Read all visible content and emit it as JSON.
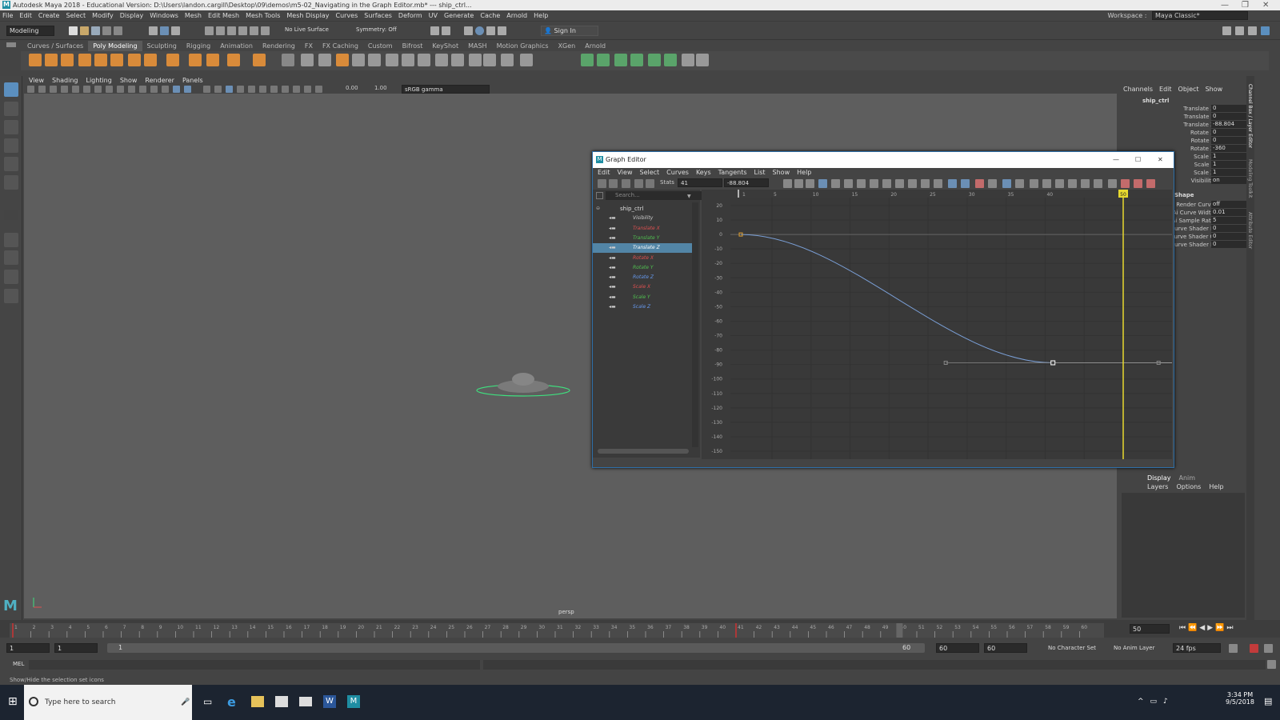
{
  "titlebar": {
    "text": "Autodesk Maya 2018 - Educational Version: D:\\Users\\landon.cargill\\Desktop\\09\\demos\\m5-02_Navigating in the Graph Editor.mb* --- ship_ctrl..."
  },
  "menubar": [
    "File",
    "Edit",
    "Create",
    "Select",
    "Modify",
    "Display",
    "Windows",
    "Mesh",
    "Edit Mesh",
    "Mesh Tools",
    "Mesh Display",
    "Curves",
    "Surfaces",
    "Deform",
    "UV",
    "Generate",
    "Cache",
    "Arnold",
    "Help"
  ],
  "workspace": {
    "label": "Workspace :",
    "value": "Maya Classic*"
  },
  "statusline": {
    "mode": "Modeling",
    "live_surface": "No Live Surface",
    "symmetry": "Symmetry: Off",
    "sign_in": "Sign In"
  },
  "shelf_tabs": [
    "Curves / Surfaces",
    "Poly Modeling",
    "Sculpting",
    "Rigging",
    "Animation",
    "Rendering",
    "FX",
    "FX Caching",
    "Custom",
    "Bifrost",
    "KeyShot",
    "MASH",
    "Motion Graphics",
    "XGen",
    "Arnold"
  ],
  "shelf_active": "Poly Modeling",
  "viewport": {
    "menu": [
      "View",
      "Shading",
      "Lighting",
      "Show",
      "Renderer",
      "Panels"
    ],
    "exposure": "0.00",
    "gamma": "1.00",
    "color_space": "sRGB gamma",
    "camera": "persp"
  },
  "channel_box": {
    "tabs": [
      "Channels",
      "Edit",
      "Object",
      "Show"
    ],
    "object": "ship_ctrl",
    "channels": [
      {
        "name": "Translate X",
        "value": "0"
      },
      {
        "name": "Translate Y",
        "value": "0"
      },
      {
        "name": "Translate Z",
        "value": "-88.804"
      },
      {
        "name": "Rotate X",
        "value": "0"
      },
      {
        "name": "Rotate Y",
        "value": "0"
      },
      {
        "name": "Rotate Z",
        "value": "-360"
      },
      {
        "name": "Scale X",
        "value": "1"
      },
      {
        "name": "Scale Y",
        "value": "1"
      },
      {
        "name": "Scale Z",
        "value": "1"
      },
      {
        "name": "Visibility",
        "value": "on"
      }
    ],
    "shape_label": "Shape",
    "shape_channels": [
      {
        "name": "Ai Render Curve",
        "value": "off"
      },
      {
        "name": "Ai Curve Width",
        "value": "0.01"
      },
      {
        "name": "Ai Sample Rate",
        "value": "5"
      },
      {
        "name": "Ai Curve Shader R",
        "value": "0"
      },
      {
        "name": "Ai Curve Shader G",
        "value": "0"
      },
      {
        "name": "Ai Curve Shader B",
        "value": "0"
      }
    ]
  },
  "layer_editor": {
    "tabs": [
      "Display",
      "Anim"
    ],
    "menu": [
      "Layers",
      "Options",
      "Help"
    ]
  },
  "side_tabs": [
    "Channel Box / Layer Editor",
    "Modeling Toolkit",
    "Attribute Editor"
  ],
  "graph_editor": {
    "title": "Graph Editor",
    "menu": [
      "Edit",
      "View",
      "Select",
      "Curves",
      "Keys",
      "Tangents",
      "List",
      "Show",
      "Help"
    ],
    "stats_label": "Stats",
    "stats_frame": "41",
    "stats_value": "-88.804",
    "search_placeholder": "Search...",
    "outliner": [
      {
        "label": "ship_ctrl",
        "color": "#dddddd",
        "root": true
      },
      {
        "label": "Visibility",
        "color": "#cccccc"
      },
      {
        "label": "Translate X",
        "color": "#e05050"
      },
      {
        "label": "Translate Y",
        "color": "#50c050"
      },
      {
        "label": "Translate Z",
        "color": "#ffffff",
        "selected": true
      },
      {
        "label": "Rotate X",
        "color": "#e05050"
      },
      {
        "label": "Rotate Y",
        "color": "#50c050"
      },
      {
        "label": "Rotate Z",
        "color": "#6699ee"
      },
      {
        "label": "Scale X",
        "color": "#e05050"
      },
      {
        "label": "Scale Y",
        "color": "#50c050"
      },
      {
        "label": "Scale Z",
        "color": "#6699ee"
      }
    ],
    "graph": {
      "x_ticks": [
        "1",
        "5",
        "10",
        "15",
        "20",
        "25",
        "30",
        "35",
        "40"
      ],
      "y_ticks": [
        "20",
        "10",
        "0",
        "-10",
        "-20",
        "-30",
        "-40",
        "-50",
        "-60",
        "-70",
        "-80",
        "-90",
        "-100",
        "-110",
        "-120",
        "-130",
        "-140",
        "-150"
      ],
      "current_frame": "50",
      "curve": {
        "name": "Translate Z",
        "keys": [
          {
            "frame": 1,
            "value": 0
          },
          {
            "frame": 41,
            "value": -88.804
          }
        ]
      },
      "curve_color": "#7a9fd6"
    }
  },
  "timeline": {
    "ticks": [
      "1",
      "2",
      "3",
      "4",
      "5",
      "6",
      "7",
      "8",
      "9",
      "10",
      "11",
      "12",
      "13",
      "14",
      "15",
      "16",
      "17",
      "18",
      "19",
      "20",
      "21",
      "22",
      "23",
      "24",
      "25",
      "26",
      "27",
      "28",
      "29",
      "30",
      "31",
      "32",
      "33",
      "34",
      "35",
      "36",
      "37",
      "38",
      "39",
      "40",
      "41",
      "42",
      "43",
      "44",
      "45",
      "46",
      "47",
      "48",
      "49",
      "50",
      "51",
      "52",
      "53",
      "54",
      "55",
      "56",
      "57",
      "58",
      "59",
      "60"
    ],
    "current_frame_field": "50",
    "current_frame": "50"
  },
  "range": {
    "start": "1",
    "start2": "1",
    "range_start": "1",
    "range_end": "60",
    "end": "60",
    "end2": "60",
    "char_set": "No Character Set",
    "anim_layer": "No Anim Layer",
    "fps": "24 fps"
  },
  "cmdline": {
    "label": "MEL"
  },
  "helpline": "Show/Hide the selection set icons",
  "taskbar": {
    "search": "Type here to search",
    "time": "3:34 PM",
    "date": "9/5/2018"
  }
}
